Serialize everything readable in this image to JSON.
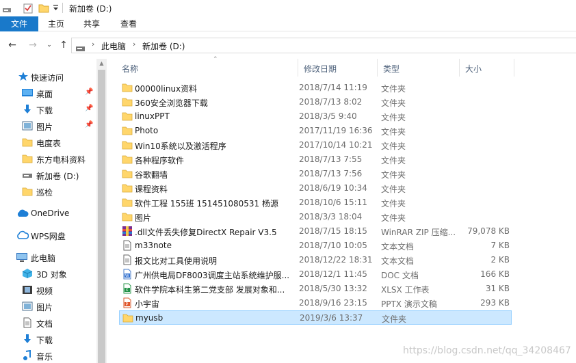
{
  "window": {
    "title": "新加卷 (D:)"
  },
  "ribbon": {
    "tabs": [
      "文件",
      "主页",
      "共享",
      "查看"
    ]
  },
  "address": {
    "crumbs": [
      "此电脑",
      "新加卷 (D:)"
    ]
  },
  "sidebar": {
    "items": [
      {
        "label": "快速访问",
        "icon": "star-icon",
        "pinned": false
      },
      {
        "label": "桌面",
        "icon": "desktop-icon",
        "pinned": true
      },
      {
        "label": "下载",
        "icon": "download-icon",
        "pinned": true
      },
      {
        "label": "图片",
        "icon": "pictures-icon",
        "pinned": true
      },
      {
        "label": "电度表",
        "icon": "folder-icon",
        "pinned": false
      },
      {
        "label": "东方电科资料",
        "icon": "folder-icon",
        "pinned": false
      },
      {
        "label": "新加卷 (D:)",
        "icon": "drive-icon",
        "pinned": false
      },
      {
        "label": "巡检",
        "icon": "folder-icon",
        "pinned": false
      },
      {
        "label": "OneDrive",
        "icon": "cloud-icon",
        "pinned": false
      },
      {
        "label": "WPS网盘",
        "icon": "cloud-icon",
        "pinned": false
      },
      {
        "label": "此电脑",
        "icon": "pc-icon",
        "pinned": false
      },
      {
        "label": "3D 对象",
        "icon": "cube-icon",
        "pinned": false
      },
      {
        "label": "视频",
        "icon": "video-icon",
        "pinned": false
      },
      {
        "label": "图片",
        "icon": "pictures-icon",
        "pinned": false
      },
      {
        "label": "文档",
        "icon": "documents-icon",
        "pinned": false
      },
      {
        "label": "下载",
        "icon": "download-icon",
        "pinned": false
      },
      {
        "label": "音乐",
        "icon": "music-icon",
        "pinned": false
      }
    ]
  },
  "columns": [
    "名称",
    "修改日期",
    "类型",
    "大小"
  ],
  "files": [
    {
      "name": "00000linux资料",
      "date": "2018/7/14 11:19",
      "type": "文件夹",
      "size": "",
      "icon": "folder"
    },
    {
      "name": "360安全浏览器下载",
      "date": "2018/7/13 8:02",
      "type": "文件夹",
      "size": "",
      "icon": "folder"
    },
    {
      "name": "linuxPPT",
      "date": "2018/3/5 9:40",
      "type": "文件夹",
      "size": "",
      "icon": "folder"
    },
    {
      "name": "Photo",
      "date": "2017/11/19 16:36",
      "type": "文件夹",
      "size": "",
      "icon": "folder"
    },
    {
      "name": "Win10系统以及激活程序",
      "date": "2017/10/14 10:21",
      "type": "文件夹",
      "size": "",
      "icon": "folder"
    },
    {
      "name": "各种程序软件",
      "date": "2018/7/13 7:55",
      "type": "文件夹",
      "size": "",
      "icon": "folder"
    },
    {
      "name": "谷歌翻墙",
      "date": "2018/7/13 7:56",
      "type": "文件夹",
      "size": "",
      "icon": "folder"
    },
    {
      "name": "课程资料",
      "date": "2018/6/19 10:34",
      "type": "文件夹",
      "size": "",
      "icon": "folder"
    },
    {
      "name": "软件工程 155班 151451080531 杨源",
      "date": "2018/10/6 15:11",
      "type": "文件夹",
      "size": "",
      "icon": "folder"
    },
    {
      "name": "图片",
      "date": "2018/3/3 18:04",
      "type": "文件夹",
      "size": "",
      "icon": "folder"
    },
    {
      "name": ".dll文件丢失修复DirectX Repair V3.5",
      "date": "2018/7/15 18:15",
      "type": "WinRAR ZIP 压缩...",
      "size": "79,078 KB",
      "icon": "rar"
    },
    {
      "name": "m33note",
      "date": "2018/7/10 10:05",
      "type": "文本文档",
      "size": "7 KB",
      "icon": "text"
    },
    {
      "name": "报文比对工具使用说明",
      "date": "2018/12/22 18:31",
      "type": "文本文档",
      "size": "2 KB",
      "icon": "text"
    },
    {
      "name": "广州供电局DF8003调度主站系统维护服...",
      "date": "2018/12/1 11:45",
      "type": "DOC 文档",
      "size": "166 KB",
      "icon": "doc"
    },
    {
      "name": "软件学院本科生第二党支部 发展对象和...",
      "date": "2018/5/30 13:32",
      "type": "XLSX 工作表",
      "size": "31 KB",
      "icon": "xlsx"
    },
    {
      "name": "小宇宙",
      "date": "2018/9/16 23:15",
      "type": "PPTX 演示文稿",
      "size": "293 KB",
      "icon": "pptx"
    },
    {
      "name": "myusb",
      "date": "2019/3/6 13:37",
      "type": "文件夹",
      "size": "",
      "icon": "folder",
      "selected": true
    }
  ],
  "watermark": "https://blog.csdn.net/qq_34208467",
  "colors": {
    "accent": "#1979ca",
    "folder": "#ffd66b",
    "selection": "#cce8ff"
  }
}
